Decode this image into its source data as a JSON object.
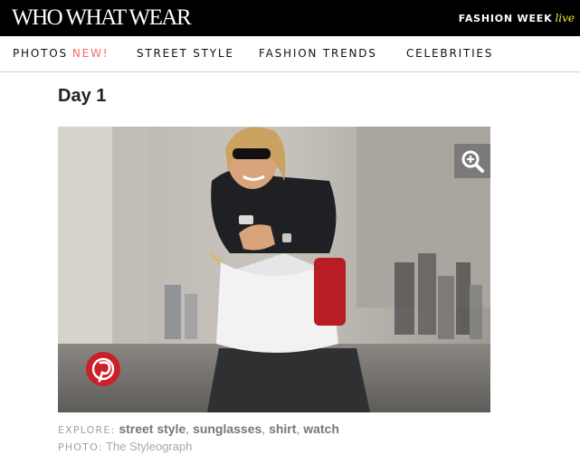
{
  "header": {
    "logo": "WHO WHAT WEAR",
    "fashion_week": "FASHION WEEK",
    "live": "live"
  },
  "nav": {
    "items": [
      {
        "label": "PHOTOS",
        "badge": "NEW!"
      },
      {
        "label": "STREET STYLE"
      },
      {
        "label": "FASHION TRENDS"
      },
      {
        "label": "CELEBRITIES"
      }
    ]
  },
  "article": {
    "title": "Day 1",
    "image_icons": {
      "zoom": "zoom-in-icon",
      "share": "pinterest-icon"
    },
    "explore": {
      "label": "EXPLORE:",
      "tags": [
        "street style",
        "sunglasses",
        "shirt",
        "watch"
      ]
    },
    "credit": {
      "label": "PHOTO:",
      "value": "The Styleograph"
    }
  },
  "colors": {
    "header_bg": "#000000",
    "accent_new": "#f26b6b",
    "live": "#f5ec3d",
    "pinterest": "#cb2027"
  }
}
